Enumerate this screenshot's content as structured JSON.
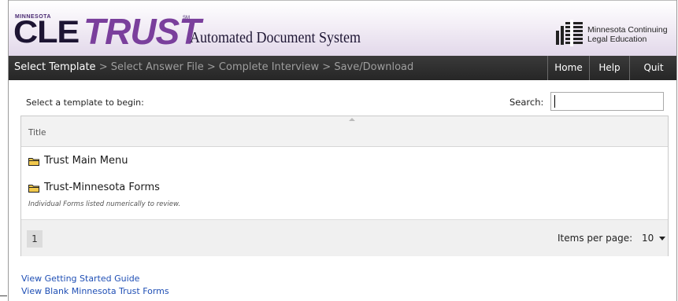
{
  "banner": {
    "logo_state": "MINNESOTA",
    "logo_cle": "CLE",
    "logo_trust": "TRUST",
    "logo_sm": "SM",
    "subtitle": "Automated Document System",
    "org_line1": "Minnesota Continuing",
    "org_line2": "Legal Education"
  },
  "nav": {
    "step_current": "Select Template",
    "step_sep": " > ",
    "step_2": "Select Answer File",
    "step_3": "Complete Interview",
    "step_4": "Save/Download",
    "home": "Home",
    "help": "Help",
    "quit": "Quit"
  },
  "content": {
    "select_label": "Select a template to begin:",
    "search_label": "Search:",
    "search_value": ""
  },
  "grid": {
    "column_title": "Title",
    "rows": [
      {
        "title": "Trust Main Menu",
        "description": ""
      },
      {
        "title": "Trust-Minnesota Forms",
        "description": "Individual Forms listed numerically to review."
      }
    ],
    "page": "1",
    "items_per_page_label": "Items per page:",
    "items_per_page_value": "10"
  },
  "links": {
    "getting_started": "View Getting Started Guide",
    "blank_forms": "View Blank Minnesota Trust Forms"
  },
  "colors": {
    "brand_purple": "#7a3f9c",
    "nav_bg": "#2e2e2e",
    "link_blue": "#1f4fb5",
    "folder_yellow": "#f2c94c"
  }
}
